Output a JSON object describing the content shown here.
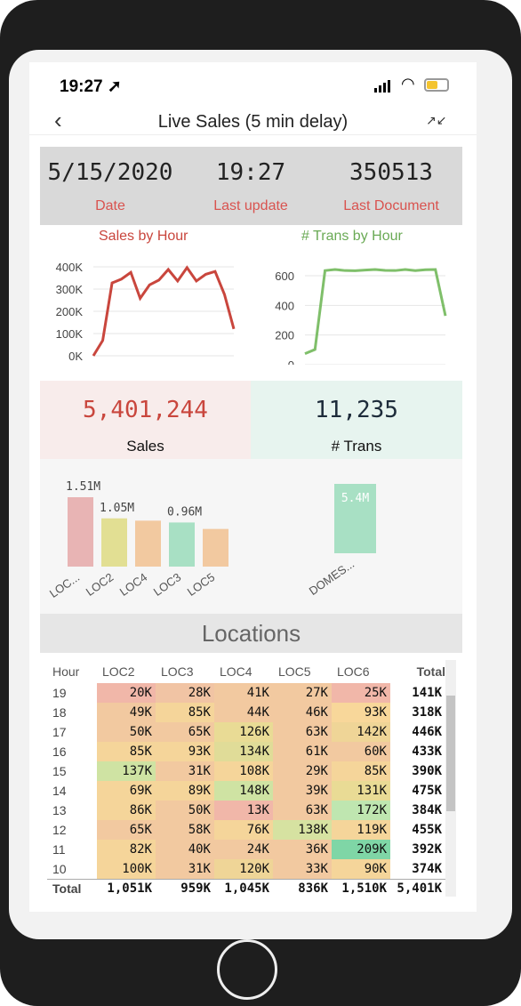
{
  "status": {
    "time": "19:27 ➚"
  },
  "header": {
    "title": "Live Sales (5 min delay)",
    "back_icon": "‹",
    "collapse_icon": "↗↙"
  },
  "kpis": [
    {
      "value": "5/15/2020",
      "label": "Date"
    },
    {
      "value": "19:27",
      "label": "Last update"
    },
    {
      "value": "350513",
      "label": "Last Document"
    }
  ],
  "charts": {
    "sales_title": "Sales by Hour",
    "trans_title": "# Trans by Hour",
    "sales_yticks": [
      "400K",
      "300K",
      "200K",
      "100K",
      "0K"
    ],
    "trans_yticks": [
      "600",
      "400",
      "200",
      "0"
    ]
  },
  "chart_data": [
    {
      "type": "line",
      "title": "Sales by Hour",
      "values": [
        0,
        80000,
        380000,
        400000,
        435000,
        300000,
        370000,
        395000,
        450000,
        390000,
        460000,
        390000,
        425000,
        440000,
        320000,
        140000
      ],
      "ylim": [
        0,
        450000
      ],
      "color": "#c9463d"
    },
    {
      "type": "line",
      "title": "# Trans by Hour",
      "values": [
        20,
        60,
        810,
        820,
        810,
        808,
        815,
        820,
        812,
        810,
        820,
        810,
        818,
        820,
        380
      ],
      "ylim": [
        0,
        820
      ],
      "color": "#7fbf6a"
    },
    {
      "type": "bar",
      "categories": [
        "LOC...",
        "LOC2",
        "LOC4",
        "LOC3",
        "LOC5"
      ],
      "values": [
        1.51,
        1.05,
        1.0,
        0.96,
        0.82
      ],
      "labels": [
        "1.51M",
        "1.05M",
        "",
        "0.96M",
        ""
      ],
      "colors": [
        "#e8b4b4",
        "#e2df93",
        "#f2c9a0",
        "#a8e0c4",
        "#f2c9a0"
      ]
    },
    {
      "type": "bar",
      "categories": [
        "DOMES..."
      ],
      "values": [
        5.4
      ],
      "labels": [
        "5.4M"
      ],
      "colors": [
        "#a8e0c4"
      ]
    }
  ],
  "big": {
    "sales_value": "5,401,244",
    "sales_label": "Sales",
    "trans_value": "11,235",
    "trans_label": "# Trans"
  },
  "locations": {
    "title": "Locations"
  },
  "table": {
    "headers": [
      "Hour",
      "LOC2",
      "LOC3",
      "LOC4",
      "LOC5",
      "LOC6",
      "Total"
    ],
    "rows": [
      [
        "19",
        "20K",
        "28K",
        "41K",
        "27K",
        "25K",
        "141K"
      ],
      [
        "18",
        "49K",
        "85K",
        "44K",
        "46K",
        "93K",
        "318K"
      ],
      [
        "17",
        "50K",
        "65K",
        "126K",
        "63K",
        "142K",
        "446K"
      ],
      [
        "16",
        "85K",
        "93K",
        "134K",
        "61K",
        "60K",
        "433K"
      ],
      [
        "15",
        "137K",
        "31K",
        "108K",
        "29K",
        "85K",
        "390K"
      ],
      [
        "14",
        "69K",
        "89K",
        "148K",
        "39K",
        "131K",
        "475K"
      ],
      [
        "13",
        "86K",
        "50K",
        "13K",
        "63K",
        "172K",
        "384K"
      ],
      [
        "12",
        "65K",
        "58K",
        "76K",
        "138K",
        "119K",
        "455K"
      ],
      [
        "11",
        "82K",
        "40K",
        "24K",
        "36K",
        "209K",
        "392K"
      ],
      [
        "10",
        "100K",
        "31K",
        "120K",
        "33K",
        "90K",
        "374K"
      ]
    ],
    "cell_colors": [
      [
        "#f1b7a9",
        "#f1c4a4",
        "#f2c9a0",
        "#f2c9a0",
        "#f1b7a9"
      ],
      [
        "#f2c9a0",
        "#f5d59a",
        "#f2c9a0",
        "#f2c9a0",
        "#f8d79a"
      ],
      [
        "#f2c9a0",
        "#f2c9a0",
        "#e9db95",
        "#f2c9a0",
        "#efd597"
      ],
      [
        "#f5d59a",
        "#f5d59a",
        "#e0dc98",
        "#f2c9a0",
        "#f2c9a0"
      ],
      [
        "#cfe3a3",
        "#f2c9a0",
        "#f5d59a",
        "#f2c9a0",
        "#f5d59a"
      ],
      [
        "#f5d59a",
        "#f5d59a",
        "#cfe3a3",
        "#f2c9a0",
        "#e9db95"
      ],
      [
        "#f5d59a",
        "#f2c9a0",
        "#f1b7a9",
        "#f2c9a0",
        "#bfe6b0"
      ],
      [
        "#f2c9a0",
        "#f2c9a0",
        "#f5d59a",
        "#d6e2a1",
        "#f5d59a"
      ],
      [
        "#f5d59a",
        "#f2c9a0",
        "#f2c9a0",
        "#f2c9a0",
        "#7fd6a6"
      ],
      [
        "#f5d59a",
        "#f2c9a0",
        "#efd597",
        "#f2c9a0",
        "#f5d59a"
      ]
    ],
    "total_row": [
      "Total",
      "1,051K",
      "959K",
      "1,045K",
      "836K",
      "1,510K",
      "5,401K"
    ]
  }
}
